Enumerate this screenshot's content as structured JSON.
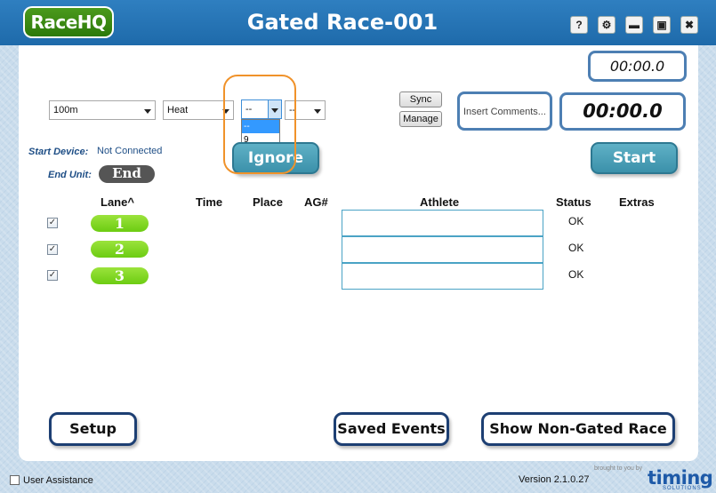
{
  "app": {
    "logo_text": "RaceHQ",
    "title": "Gated Race-001",
    "window_buttons": [
      {
        "name": "help-icon",
        "glyph": "?"
      },
      {
        "name": "settings-gear-icon",
        "glyph": "⚙"
      },
      {
        "name": "minimize-icon",
        "glyph": "▬"
      },
      {
        "name": "maximize-icon",
        "glyph": "▣"
      },
      {
        "name": "close-icon",
        "glyph": "✖"
      }
    ]
  },
  "controls": {
    "distance_select": "100m",
    "heat_select": "Heat",
    "heat_number_select": "--",
    "extra_select": "--",
    "heat_number_dropdown": [
      "--",
      "9"
    ],
    "sync_label": "Sync",
    "manage_label": "Manage",
    "comments_placeholder": "Insert Comments...",
    "timer_small": "00:00.0",
    "timer_main": "00:00.0",
    "ignore_label": "Ignore",
    "start_label": "Start"
  },
  "devices": {
    "start_device_label": "Start Device:",
    "start_device_value": "Not Connected",
    "end_unit_label": "End Unit:",
    "end_unit_button": "End"
  },
  "table": {
    "headers": [
      "Lane^",
      "Time",
      "Place",
      "AG#",
      "Athlete",
      "Status",
      "Extras"
    ],
    "rows": [
      {
        "lane": "1",
        "checked": true,
        "status": "OK",
        "athlete": ""
      },
      {
        "lane": "2",
        "checked": true,
        "status": "OK",
        "athlete": ""
      },
      {
        "lane": "3",
        "checked": true,
        "status": "OK",
        "athlete": ""
      }
    ]
  },
  "bottom_buttons": {
    "setup": "Setup",
    "saved_events": "Saved Events",
    "show_non_gated": "Show Non-Gated Race"
  },
  "footer": {
    "user_assistance": "User Assistance",
    "version": "Version 2.1.0.27",
    "brought_by": "brought to you by",
    "brand": "timing",
    "brand_sub": "SOLUTIONS"
  },
  "colors": {
    "titlebar": "#2378b8",
    "lane_green": "#7bd61f",
    "teal_button": "#4aa0b8",
    "dark_border": "#1d3f73",
    "highlight_orange": "#f0922a"
  }
}
